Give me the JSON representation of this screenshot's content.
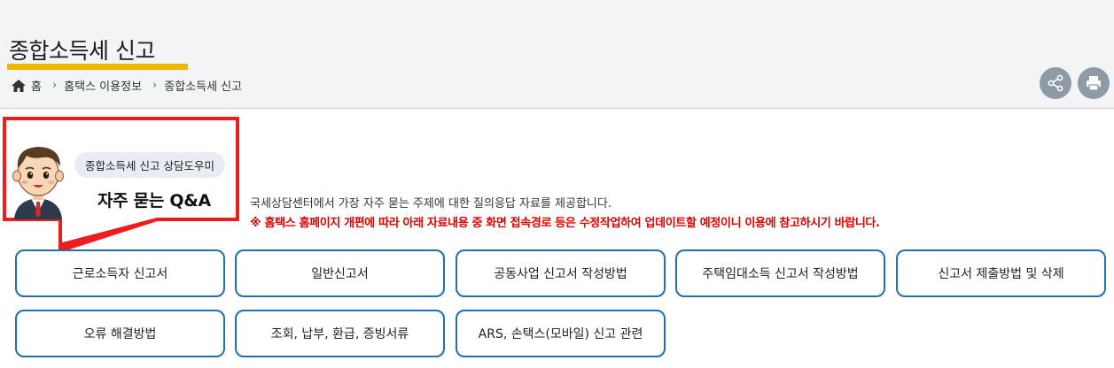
{
  "header": {
    "title": "종합소득세 신고",
    "accent_color": "#f0b800"
  },
  "breadcrumb": {
    "home": "홈",
    "items": [
      "홈택스 이용정보",
      "종합소득세 신고"
    ]
  },
  "toolbar": {
    "share_icon": "share-icon",
    "print_icon": "printer-icon"
  },
  "helper": {
    "bubble": "종합소득세 신고 상담도우미",
    "title": "자주 묻는 Q&A",
    "border_color": "#ee1c1c"
  },
  "intro": "국세상담센터에서 가장 자주 묻는 주제에 대한 질의응답 자료를 제공합니다.",
  "notice": "※ 홈택스 홈페이지 개편에 따라 아래 자료내용 중 화면 접속경로 등은 수정작업하여 업데이트할 예정이니 이용에 참고하시기 바랍니다.",
  "notice_color": "#e00000",
  "menu": [
    "근로소득자 신고서",
    "일반신고서",
    "공동사업 신고서 작성방법",
    "주택임대소득 신고서 작성방법",
    "신고서 제출방법 및 삭제",
    "오류 해결방법",
    "조회, 납부, 환급, 증빙서류",
    "ARS, 손택스(모바일) 신고 관련"
  ],
  "button_border_color": "#1f6fb2"
}
